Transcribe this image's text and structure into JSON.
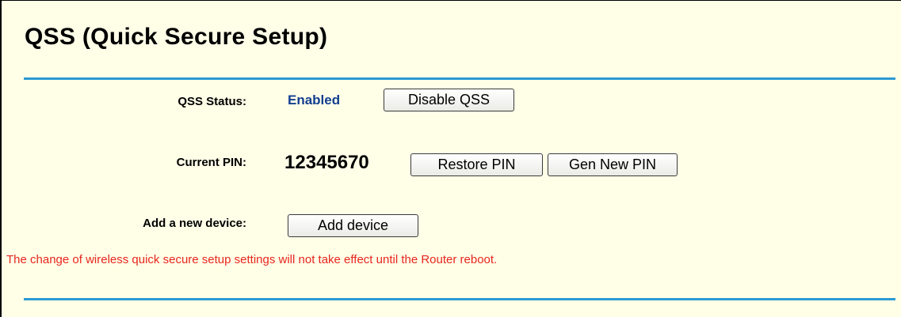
{
  "title": "QSS (Quick Secure Setup)",
  "status": {
    "label": "QSS Status:",
    "value": "Enabled",
    "button_label": "Disable QSS"
  },
  "pin": {
    "label": "Current PIN:",
    "value": "12345670",
    "restore_label": "Restore PIN",
    "gen_label": "Gen New PIN"
  },
  "add_device": {
    "label": "Add a new device:",
    "button_label": "Add device"
  },
  "notice": "The change of wireless quick secure setup settings will not take effect until the Router reboot.",
  "colors": {
    "background": "#ffffe8",
    "accent_rule": "#2a9ad3",
    "status_value": "#123e90",
    "notice": "#e8261e"
  }
}
